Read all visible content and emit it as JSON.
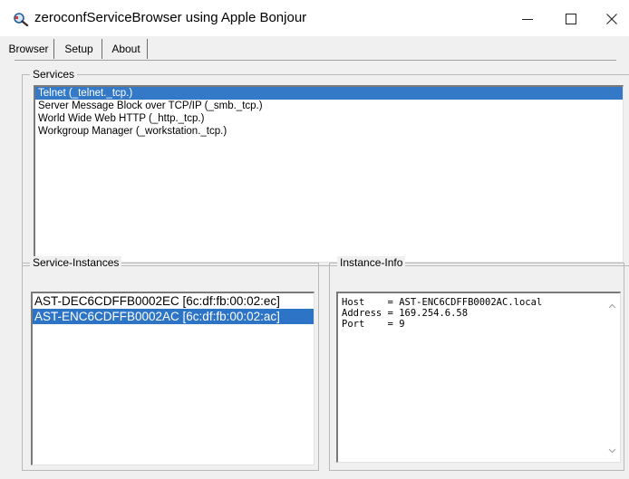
{
  "window": {
    "title": "zeroconfServiceBrowser using Apple Bonjour"
  },
  "tabs": [
    {
      "label": "Browser",
      "active": true
    },
    {
      "label": "Setup",
      "active": false
    },
    {
      "label": "About",
      "active": false
    }
  ],
  "services": {
    "legend": "Services",
    "items": [
      {
        "label": "Telnet (_telnet._tcp.)",
        "selected": true
      },
      {
        "label": "Server Message Block over TCP/IP (_smb._tcp.)",
        "selected": false
      },
      {
        "label": "World Wide Web HTTP (_http._tcp.)",
        "selected": false
      },
      {
        "label": "Workgroup Manager (_workstation._tcp.)",
        "selected": false
      }
    ]
  },
  "instances": {
    "legend": "Service-Instances",
    "items": [
      {
        "label": "AST-DEC6CDFFB0002EC [6c:df:fb:00:02:ec]",
        "selected": false
      },
      {
        "label": "AST-ENC6CDFFB0002AC [6c:df:fb:00:02:ac]",
        "selected": true
      }
    ]
  },
  "info": {
    "legend": "Instance-Info",
    "lines": [
      "Host    = AST-ENC6CDFFB0002AC.local",
      "Address = 169.254.6.58",
      "Port    = 9"
    ]
  },
  "colors": {
    "selection": "#3478c8",
    "window_bg": "#f0f0f0"
  }
}
